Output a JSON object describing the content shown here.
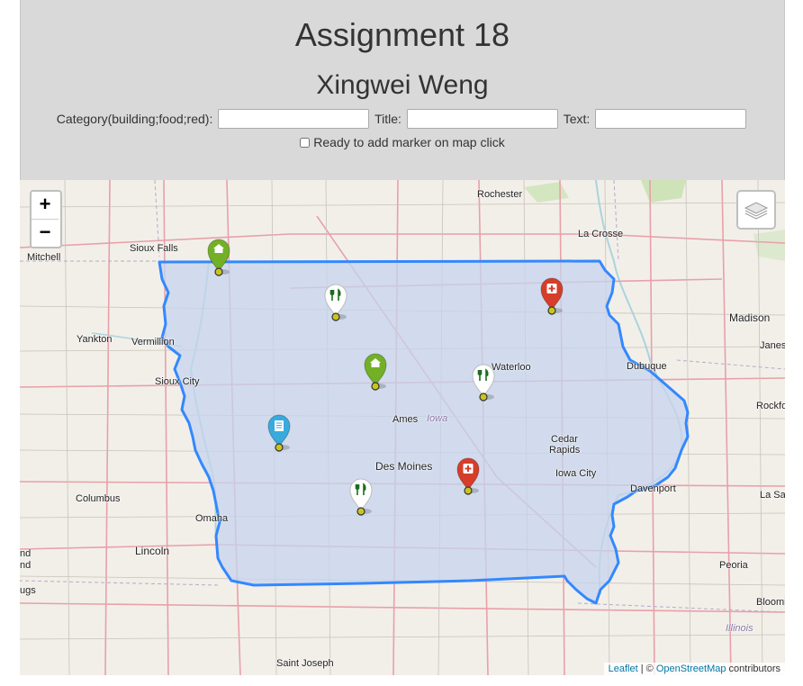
{
  "header": {
    "title": "Assignment 18",
    "subtitle": "Xingwei Weng",
    "category_label": "Category(building;food;red):",
    "category_value": "",
    "title_label": "Title:",
    "title_value": "",
    "text_label": "Text:",
    "text_value": "",
    "ready_checkbox_label": "Ready to add marker on map click",
    "ready_checked": false
  },
  "map": {
    "zoom_in_label": "+",
    "zoom_out_label": "−",
    "attribution": {
      "leaflet": "Leaflet",
      "separator": " | © ",
      "osm": "OpenStreetMap",
      "suffix": " contributors"
    },
    "state_overlay": {
      "fill": "#c5d4ee",
      "stroke": "#3388ff"
    },
    "labels": {
      "rochester": "Rochester",
      "la_crosse": "La Crosse",
      "sioux_falls": "Sioux Falls",
      "mitchell": "Mitchell",
      "madison": "Madison",
      "janesville": "Janesv",
      "yankton": "Yankton",
      "vermillion": "Vermillion",
      "waterloo": "Waterloo",
      "dubuque": "Dubuque",
      "sioux_city": "Sioux City",
      "ames": "Ames",
      "iowa": "Iowa",
      "rockford": "Rockfo",
      "cedar_rapids_1": "Cedar",
      "cedar_rapids_2": "Rapids",
      "des_moines": "Des Moines",
      "iowa_city": "Iowa City",
      "davenport": "Davenport",
      "la_salle": "La Sall",
      "columbus": "Columbus",
      "omaha": "Omaha",
      "lincoln": "Lincoln",
      "peoria": "Peoria",
      "bloomington": "Bloomi",
      "illinois": "Illinois",
      "saint_joseph": "Saint Joseph",
      "edge_1": "nd",
      "edge_2": "nd",
      "edge_3": "ugs"
    },
    "markers": [
      {
        "category": "building",
        "color": "#72b026",
        "icon": "home-icon"
      },
      {
        "category": "food",
        "color": "#ffffff",
        "icon": "fork-knife-icon"
      },
      {
        "category": "red",
        "color": "#d63e2a",
        "icon": "plus-icon"
      },
      {
        "category": "building",
        "color": "#72b026",
        "icon": "home-icon"
      },
      {
        "category": "food",
        "color": "#ffffff",
        "icon": "fork-knife-icon"
      },
      {
        "category": "blue",
        "color": "#38aadd",
        "icon": "document-icon"
      },
      {
        "category": "red",
        "color": "#d63e2a",
        "icon": "plus-icon"
      },
      {
        "category": "food",
        "color": "#ffffff",
        "icon": "fork-knife-icon"
      }
    ]
  }
}
